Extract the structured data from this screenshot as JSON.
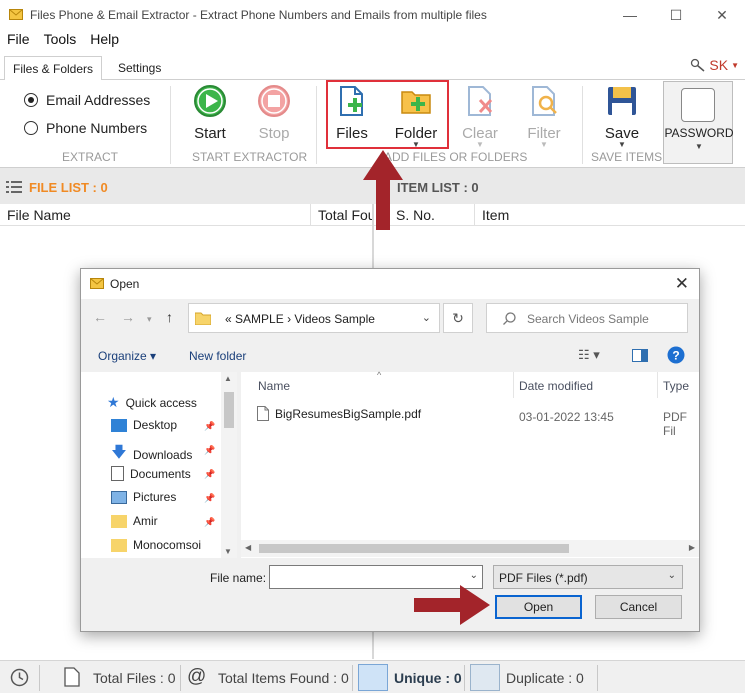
{
  "window": {
    "title": "Files Phone & Email Extractor - Extract Phone Numbers and Emails from multiple files",
    "minimize": "—",
    "maximize": "☐",
    "close": "✕"
  },
  "menu": [
    "File",
    "Tools",
    "Help"
  ],
  "tabs": {
    "active": "Files & Folders",
    "other": "Settings",
    "user": "SK"
  },
  "ribbon": {
    "extract": {
      "email": "Email Addresses",
      "phone": "Phone Numbers",
      "group": "EXTRACT"
    },
    "start": {
      "start": "Start",
      "stop": "Stop",
      "group": "START EXTRACTOR"
    },
    "add": {
      "files": "Files",
      "folder": "Folder",
      "clear": "Clear",
      "filter": "Filter",
      "group": "ADD FILES OR FOLDERS"
    },
    "save": {
      "save": "Save",
      "group": "SAVE ITEMS"
    },
    "password": "PASSWORD"
  },
  "file_list": {
    "title": "FILE LIST : 0",
    "col_name": "File Name",
    "col_total": "Total Fou"
  },
  "item_list": {
    "title": "ITEM LIST : 0",
    "col_no": "S. No.",
    "col_item": "Item"
  },
  "dialog": {
    "title": "Open",
    "path": [
      "«",
      "SAMPLE",
      "›",
      "Videos Sample"
    ],
    "search_placeholder": "Search Videos Sample",
    "organize": "Organize ▾",
    "new_folder": "New folder",
    "nav": [
      "Quick access",
      "Desktop",
      "Downloads",
      "Documents",
      "Pictures",
      "Amir",
      "Monocomsoi"
    ],
    "columns": {
      "name": "Name",
      "date": "Date modified",
      "type": "Type"
    },
    "files": [
      {
        "name": "BigResumesBigSample.pdf",
        "date": "03-01-2022 13:45",
        "type": "PDF Fil"
      }
    ],
    "file_name_label": "File name:",
    "file_name_value": "",
    "file_type": "PDF Files (*.pdf)",
    "open": "Open",
    "cancel": "Cancel"
  },
  "status": {
    "total_files": "Total Files : 0",
    "total_items": "Total Items Found : 0",
    "unique": "Unique : 0",
    "duplicate": "Duplicate : 0"
  },
  "colors": {
    "accent_orange": "#f08a24",
    "highlight_red": "#e0303a",
    "arrow": "#a3242a"
  }
}
